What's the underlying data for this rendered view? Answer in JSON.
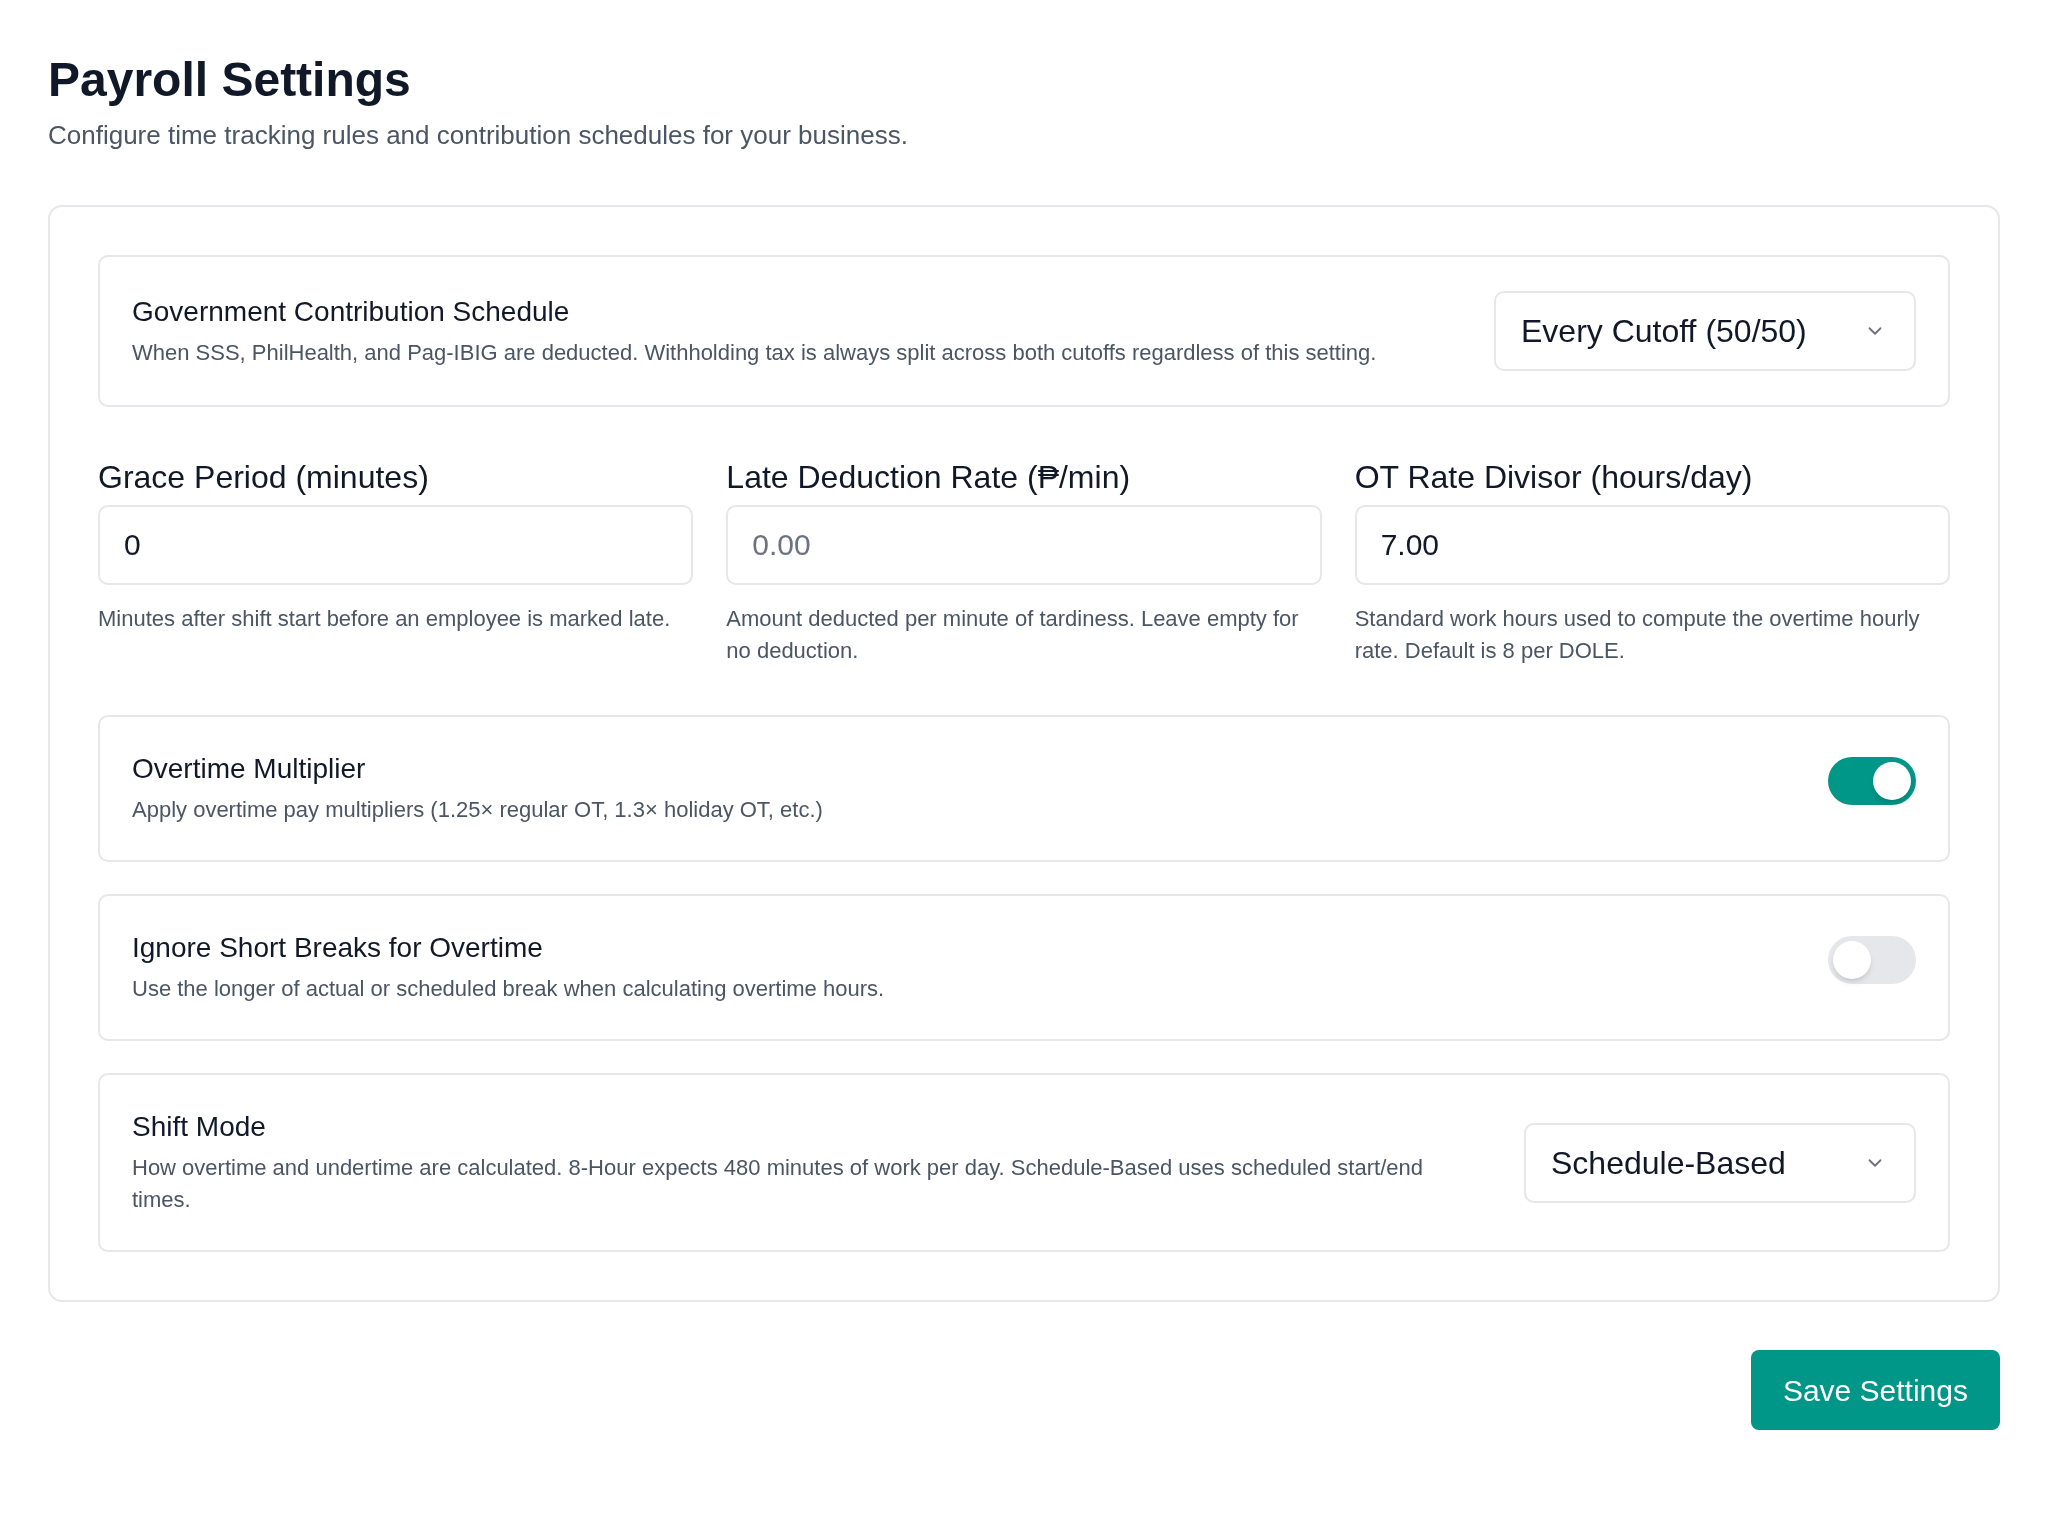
{
  "page": {
    "title": "Payroll Settings",
    "subtitle": "Configure time tracking rules and contribution schedules for your business."
  },
  "schedule": {
    "kind": "select",
    "title": "Government Contribution Schedule",
    "description": "When SSS, PhilHealth, and Pag-IBIG are deducted. Withholding tax is always split across both cutoffs regardless of this setting.",
    "value": "Every Cutoff (50/50)"
  },
  "fields": [
    {
      "label": "Grace Period (minutes)",
      "value": "0",
      "help": "Minutes after shift start before an employee is marked late."
    },
    {
      "label": "Late Deduction Rate (₱/min)",
      "placeholder": "0.00",
      "help": "Amount deducted per minute of tardiness. Leave empty for no deduction."
    },
    {
      "label": "OT Rate Divisor (hours/day)",
      "value": "7.00",
      "help": "Standard work hours used to compute the overtime hourly rate. Default is 8 per DOLE."
    }
  ],
  "options": [
    {
      "kind": "toggle",
      "title": "Overtime Multiplier",
      "description": "Apply overtime pay multipliers (1.25× regular OT, 1.3× holiday OT, etc.)",
      "on": true
    },
    {
      "kind": "toggle",
      "title": "Ignore Short Breaks for Overtime",
      "description": "Use the longer of actual or scheduled break when calculating overtime hours.",
      "on": false
    },
    {
      "kind": "select",
      "title": "Shift Mode",
      "description": "How overtime and undertime are calculated. 8-Hour expects 480 minutes of work per day. Schedule-Based uses scheduled start/end times.",
      "value": "Schedule-Based"
    }
  ],
  "save_button": "Save Settings"
}
